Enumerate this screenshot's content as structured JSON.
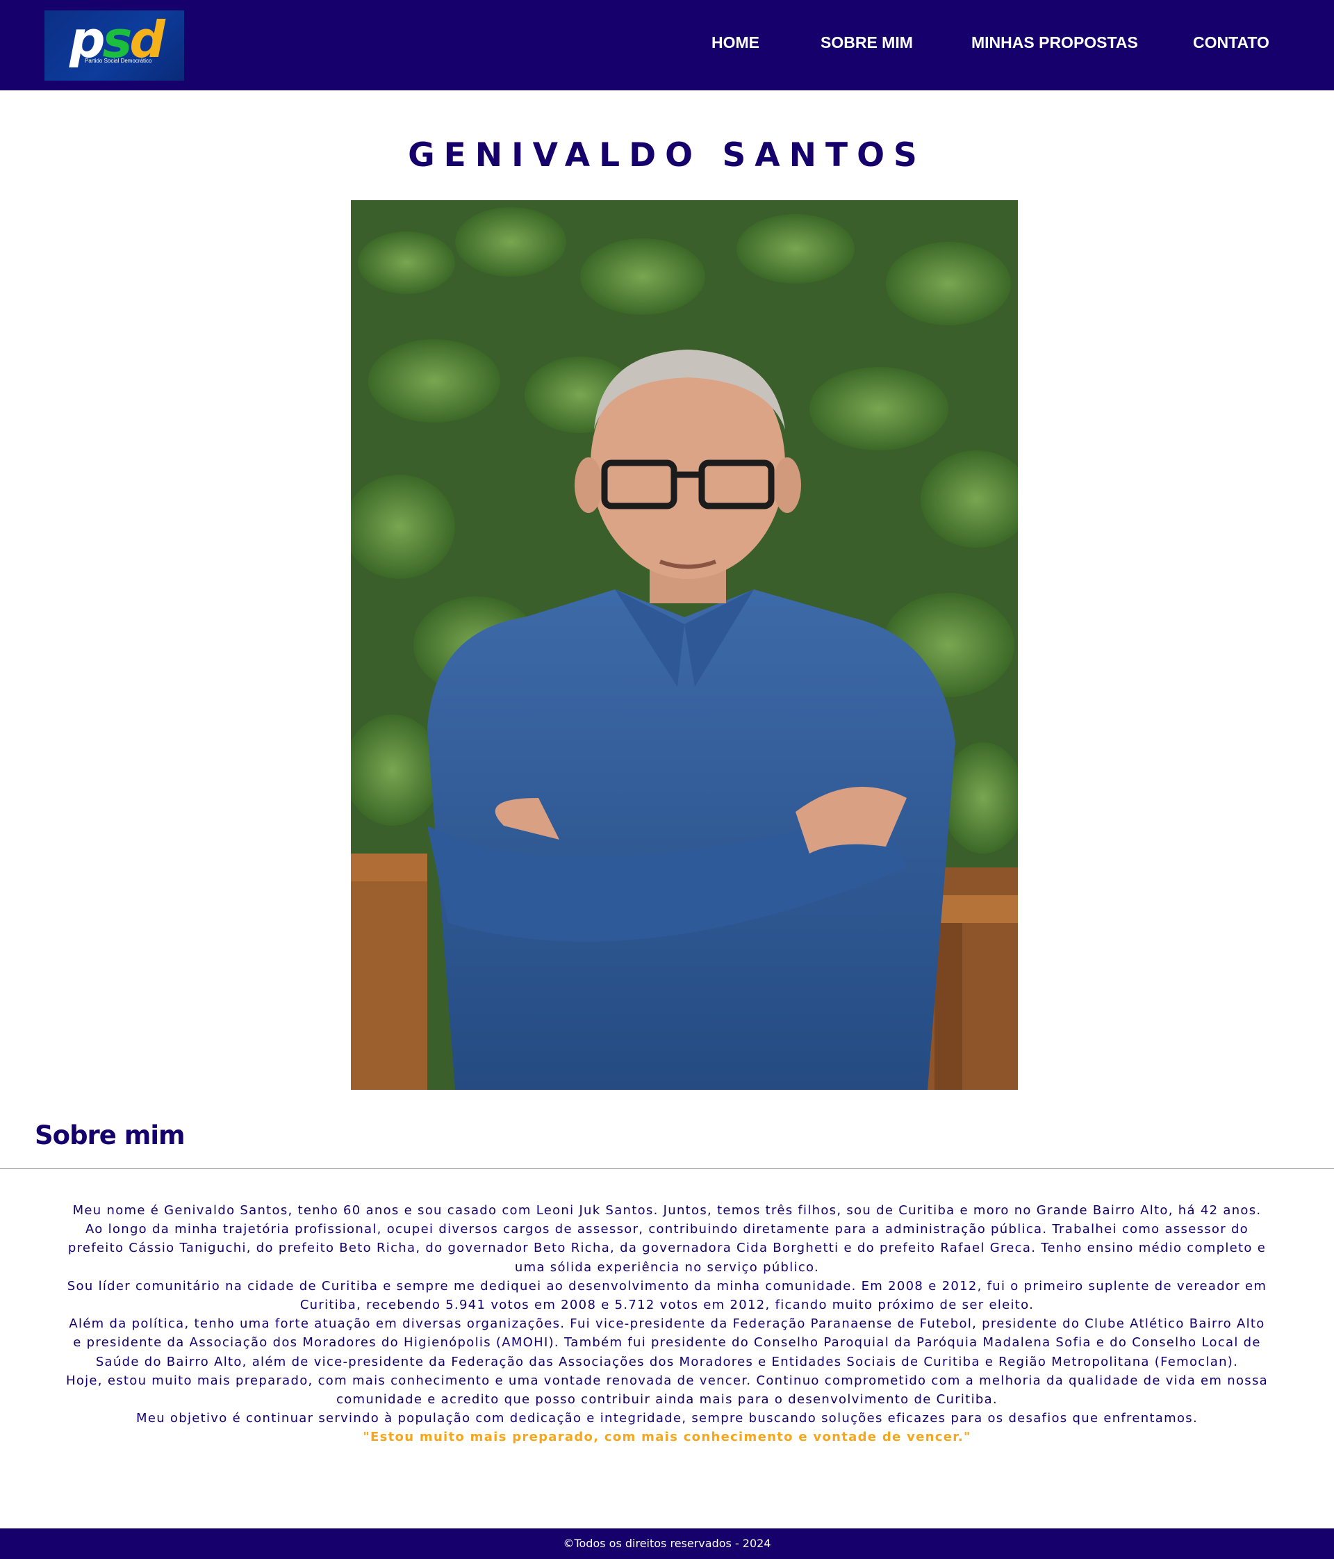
{
  "header": {
    "logo": {
      "letters": {
        "p": "p",
        "s": "s",
        "d": "d"
      },
      "subtitle": "Partido Social Democrático",
      "colors": {
        "p": "#ffffff",
        "s": "#1bbf3d",
        "d": "#f6b21b",
        "background": "#0d3c9c"
      }
    },
    "nav": {
      "home": "HOME",
      "sobre": "SOBRE MIM",
      "propostas": "MINHAS PROPOSTAS",
      "contato": "CONTATO"
    }
  },
  "main": {
    "title": "GENIVALDO SANTOS",
    "photo_icon": "portrait-photo",
    "section_title": "Sobre mim",
    "bio": [
      "Meu nome é Genivaldo Santos, tenho 60 anos e sou casado com Leoni Juk Santos. Juntos, temos três filhos, sou de Curitiba e moro no Grande Bairro Alto, há 42 anos.",
      "Ao longo da minha trajetória profissional, ocupei diversos cargos de assessor, contribuindo diretamente para a administração pública. Trabalhei como assessor do prefeito Cássio Taniguchi, do prefeito Beto Richa, do governador Beto Richa, da governadora Cida Borghetti e do prefeito Rafael Greca. Tenho ensino médio completo e uma sólida experiência no serviço público.",
      "Sou líder comunitário na cidade de Curitiba e sempre me dediquei ao desenvolvimento da minha comunidade. Em 2008 e 2012, fui o primeiro suplente de vereador em Curitiba, recebendo 5.941 votos em 2008 e 5.712 votos em 2012, ficando muito próximo de ser eleito.",
      "Além da política, tenho uma forte atuação em diversas organizações. Fui vice-presidente da Federação Paranaense de Futebol, presidente do Clube Atlético Bairro Alto e presidente da Associação dos Moradores do Higienópolis (AMOHI). Também fui presidente do Conselho Paroquial da Paróquia Madalena Sofia e do Conselho Local de Saúde do Bairro Alto, além de vice-presidente da Federação das Associações dos Moradores e Entidades Sociais de Curitiba e Região Metropolitana (Femoclan).",
      "Hoje, estou muito mais preparado, com mais conhecimento e uma vontade renovada de vencer. Continuo comprometido com a melhoria da qualidade de vida em nossa comunidade e acredito que posso contribuir ainda mais para o desenvolvimento de Curitiba.",
      "Meu objetivo é continuar servindo à população com dedicação e integridade, sempre buscando soluções eficazes para os desafios que enfrentamos."
    ],
    "quote": "\"Estou muito mais preparado, com mais conhecimento e vontade de vencer.\""
  },
  "footer": {
    "copyright": "©Todos os direitos reservados - 2024"
  },
  "colors": {
    "primary": "#16006b",
    "accent": "#f6a61b",
    "background": "#ffffff"
  }
}
